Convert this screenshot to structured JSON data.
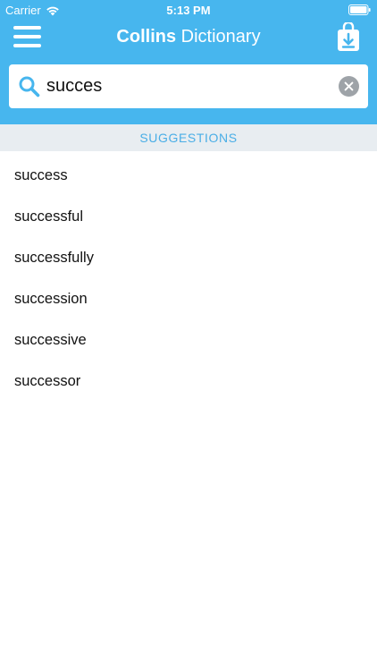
{
  "status_bar": {
    "carrier": "Carrier",
    "time": "5:13 PM"
  },
  "nav": {
    "title_brand": "Collins",
    "title_rest": " Dictionary",
    "icons": [
      "menu-icon",
      "download-icon"
    ]
  },
  "search": {
    "value": "succes",
    "placeholder": "",
    "icons": [
      "search-icon",
      "clear-icon"
    ]
  },
  "suggestions": {
    "header": "SUGGESTIONS",
    "items": [
      "success",
      "successful",
      "successfully",
      "succession",
      "successive",
      "successor"
    ]
  },
  "colors": {
    "accent": "#47b6ee",
    "section_bg": "#e8edf1",
    "section_text": "#4aaee6"
  }
}
